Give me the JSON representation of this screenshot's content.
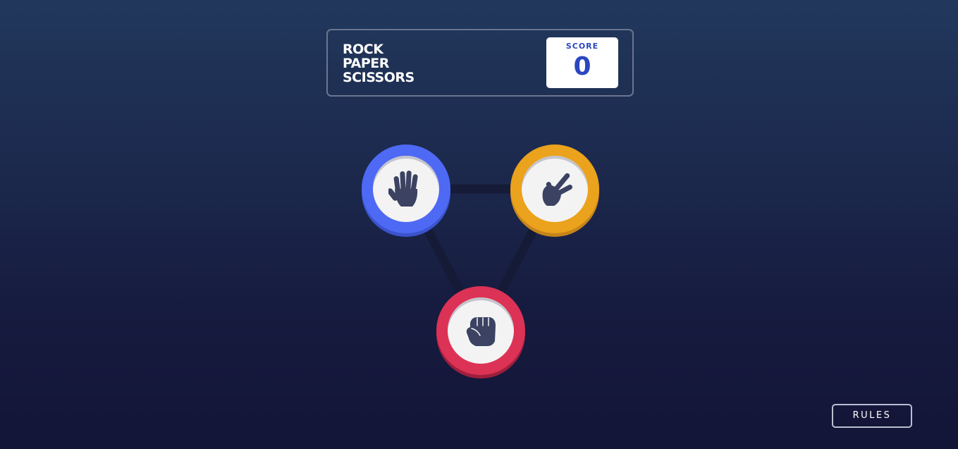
{
  "header": {
    "title_lines": [
      "ROCK",
      "PAPER",
      "SCISSORS"
    ],
    "score_label": "SCORE",
    "score_value": "0"
  },
  "tokens": [
    {
      "name": "paper",
      "icon": "paper-hand-icon",
      "color": "#4e69f3"
    },
    {
      "name": "scissors",
      "icon": "scissors-hand-icon",
      "color": "#eba21c"
    },
    {
      "name": "rock",
      "icon": "rock-fist-icon",
      "color": "#dc3255"
    }
  ],
  "rules_button": {
    "label": "RULES"
  },
  "colors": {
    "background_top": "#21385c",
    "background_bottom": "#131537",
    "score_text": "#2a46c0",
    "icon": "#3b4262"
  }
}
